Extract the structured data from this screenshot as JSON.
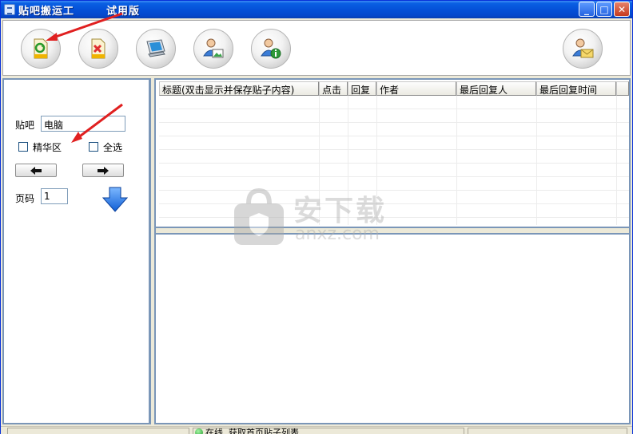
{
  "window": {
    "title": "贴吧搬运工",
    "edition": "试用版",
    "minimize_symbol": "_",
    "maximize_symbol": "□",
    "close_symbol": "✕"
  },
  "toolbar": {
    "buttons": [
      {
        "name": "refresh-doc-button",
        "icon": "document-refresh-icon"
      },
      {
        "name": "delete-doc-button",
        "icon": "document-delete-icon"
      },
      {
        "name": "computer-button",
        "icon": "computer-icon"
      },
      {
        "name": "user-picture-button",
        "icon": "user-picture-icon"
      },
      {
        "name": "user-info-button",
        "icon": "user-info-icon"
      },
      {
        "name": "user-mail-button",
        "icon": "user-mail-icon"
      }
    ]
  },
  "left_panel": {
    "tieba_label": "贴吧",
    "tieba_value": "电脑",
    "jinghua_label": "精华区",
    "select_all_label": "全选",
    "prev_icon": "arrow-left-icon",
    "next_icon": "arrow-right-icon",
    "page_label": "页码",
    "page_value": "1",
    "go_icon": "arrow-down-icon"
  },
  "table": {
    "columns": [
      "标题(双击显示并保存贴子内容)",
      "点击",
      "回复",
      "作者",
      "最后回复人",
      "最后回复时间",
      ""
    ]
  },
  "status": {
    "state_text": "在线",
    "message": "获取首页贴子列表"
  },
  "watermark": {
    "main": "安下载",
    "sub": "anxz.com"
  },
  "colors": {
    "titlebar": "#0551D8",
    "annotation_arrow": "#E02020",
    "panel_border": "#7A96B8"
  }
}
